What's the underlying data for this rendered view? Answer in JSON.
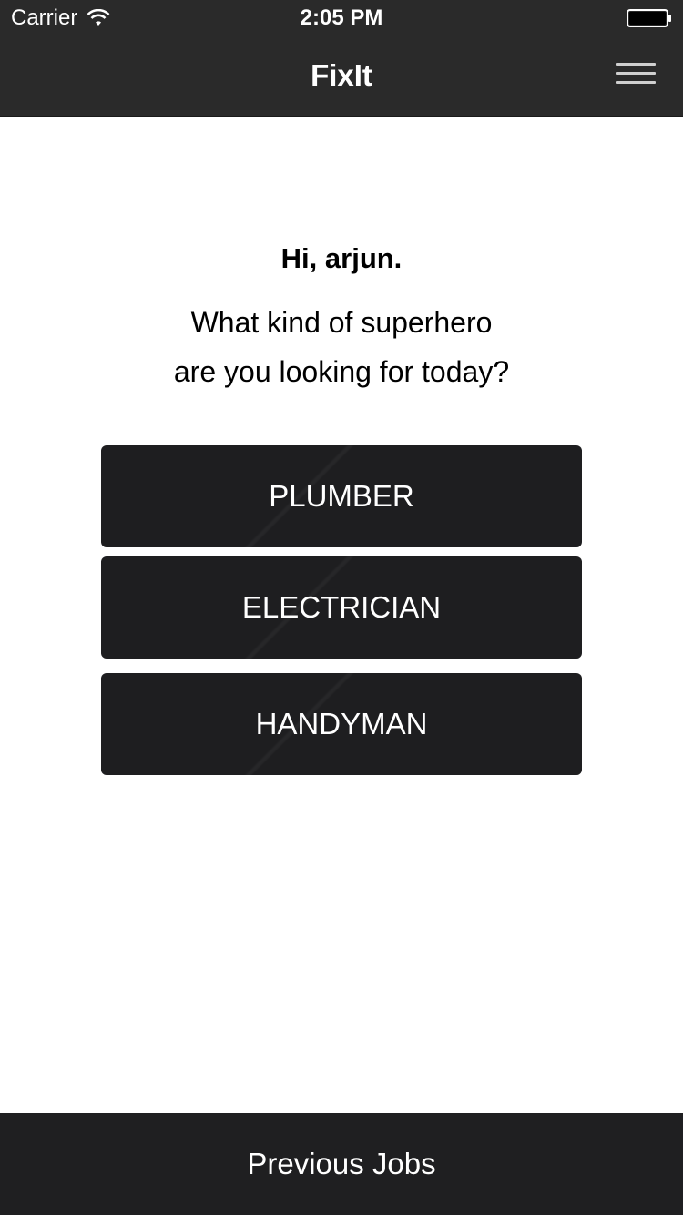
{
  "status_bar": {
    "carrier": "Carrier",
    "time": "2:05 PM",
    "icons": [
      "wifi-icon",
      "battery-icon"
    ]
  },
  "nav": {
    "title": "FixIt",
    "menu_icon": "hamburger-menu-icon"
  },
  "main": {
    "greeting": "Hi, arjun.",
    "prompt_line1": "What kind of superhero",
    "prompt_line2": "are you looking for today?",
    "categories": [
      {
        "label": "PLUMBER"
      },
      {
        "label": "ELECTRICIAN"
      },
      {
        "label": "HANDYMAN"
      }
    ]
  },
  "footer": {
    "previous_jobs_label": "Previous Jobs"
  },
  "colors": {
    "header_bg": "#2a2a2a",
    "button_bg": "#1e1e20",
    "footer_bg": "#1f1f21",
    "text_light": "#ffffff",
    "text_dark": "#000000"
  }
}
